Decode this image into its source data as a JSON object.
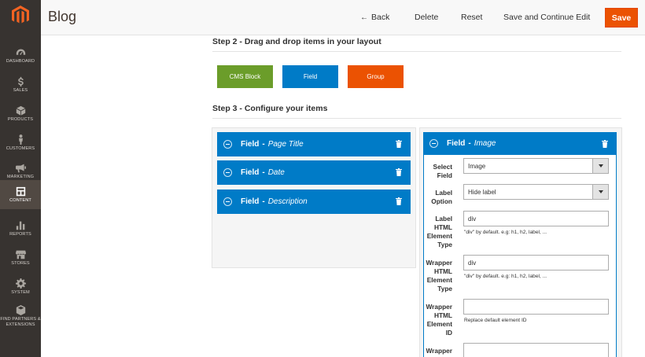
{
  "sidebar": {
    "logo": "magento-logo-icon",
    "items": [
      {
        "label": "DASHBOARD",
        "icon": "speedometer-icon"
      },
      {
        "label": "SALES",
        "icon": "dollar-icon"
      },
      {
        "label": "PRODUCTS",
        "icon": "cube-icon"
      },
      {
        "label": "CUSTOMERS",
        "icon": "person-icon"
      },
      {
        "label": "MARKETING",
        "icon": "megaphone-icon"
      },
      {
        "label": "CONTENT",
        "icon": "layout-icon",
        "active": true
      },
      {
        "label": "REPORTS",
        "icon": "bar-chart-icon"
      },
      {
        "label": "STORES",
        "icon": "storefront-icon"
      },
      {
        "label": "SYSTEM",
        "icon": "gear-icon"
      },
      {
        "label": "FIND PARTNERS & EXTENSIONS",
        "icon": "box-icon"
      }
    ]
  },
  "header": {
    "title": "Blog",
    "back_label": "Back",
    "delete_label": "Delete",
    "reset_label": "Reset",
    "save_continue_label": "Save and Continue Edit",
    "save_label": "Save"
  },
  "steps": {
    "step2_title": "Step 2 - Drag and drop items in your layout",
    "step3_title": "Step 3 - Configure your items"
  },
  "draggables": [
    {
      "label": "CMS Block",
      "color": "#6b9d2a"
    },
    {
      "label": "Field",
      "color": "#007bc7"
    },
    {
      "label": "Group",
      "color": "#eb5202"
    }
  ],
  "layout_items": [
    {
      "type": "Field",
      "name": "Page Title"
    },
    {
      "type": "Field",
      "name": "Date"
    },
    {
      "type": "Field",
      "name": "Description"
    }
  ],
  "config": {
    "header_type": "Field",
    "header_name": "Image",
    "select_field_label": "Select Field",
    "select_field_value": "Image",
    "label_option_label": "Label Option",
    "label_option_value": "Hide label",
    "label_html_label": "Label HTML Element Type",
    "label_html_value": "div",
    "label_html_hint": "\"div\" by default. e.g: h1, h2, label, ...",
    "wrapper_html_label": "Wrapper HTML Element Type",
    "wrapper_html_value": "div",
    "wrapper_html_hint": "\"div\" by default. e.g: h1, h2, label, ...",
    "wrapper_id_label": "Wrapper HTML Element ID",
    "wrapper_id_value": "",
    "wrapper_id_hint": "Replace default element ID",
    "wrapper_next_label": "Wrapper",
    "wrapper_next_value": ""
  },
  "colors": {
    "accent_blue": "#007bc7",
    "save_orange": "#eb5202",
    "cms_green": "#6b9d2a",
    "sidebar_bg": "#373330"
  }
}
